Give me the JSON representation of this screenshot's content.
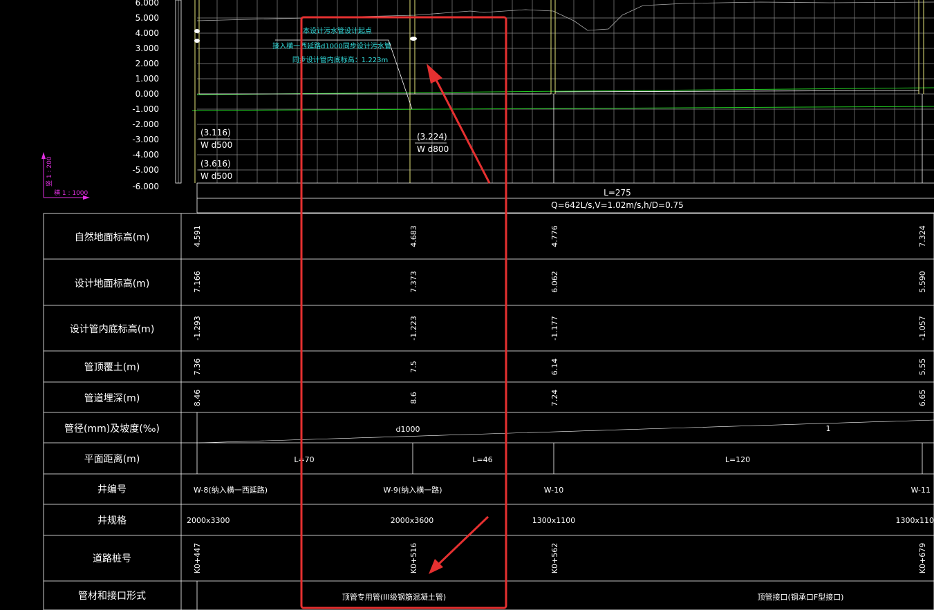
{
  "elevation_ticks": [
    "6.000",
    "5.000",
    "4.000",
    "3.000",
    "2.000",
    "1.000",
    "0.000",
    "-1.000",
    "-2.000",
    "-3.000",
    "-4.000",
    "-5.000",
    "-6.000"
  ],
  "scale": {
    "vertical": "竖 1 : 200",
    "horizontal": "横 1 : 1000"
  },
  "annotation": {
    "line1": "本设计污水管设计起点",
    "line2": "接入横一西延路d1000同步设计污水管",
    "line3": "同步设计管内底标高：1.223m"
  },
  "pipe_labels": {
    "a_elev": "(3.116)",
    "a_spec": "W d500",
    "b_elev": "(3.616)",
    "b_spec": "W d500",
    "c_elev": "(3.224)",
    "c_spec": "W d800"
  },
  "segment": {
    "length": "L=275",
    "flow": "Q=642L/s,V=1.02m/s,h/D=0.75"
  },
  "rows": [
    {
      "label": "自然地面标高(m)",
      "values": [
        "4.591",
        "4.683",
        "4.776",
        "7.324"
      ]
    },
    {
      "label": "设计地面标高(m)",
      "values": [
        "7.166",
        "7.373",
        "6.062",
        "5.590"
      ]
    },
    {
      "label": "设计管内底标高(m)",
      "values": [
        "-1.293",
        "-1.223",
        "-1.177",
        "-1.057"
      ]
    },
    {
      "label": "管顶覆土(m)",
      "values": [
        "7.36",
        "7.5",
        "6.14",
        "5.55"
      ]
    },
    {
      "label": "管道埋深(m)",
      "values": [
        "8.46",
        "8.6",
        "7.24",
        "6.65"
      ]
    },
    {
      "label": "管径(mm)及坡度(‰)",
      "values": [
        "d1000",
        "1"
      ]
    },
    {
      "label": "平面距离(m)",
      "values": [
        "L=70",
        "L=46",
        "L=120"
      ]
    },
    {
      "label": "井编号",
      "values": [
        "W-8(纳入横一西延路)",
        "W-9(纳入横一路)",
        "W-10",
        "W-11"
      ]
    },
    {
      "label": "井规格",
      "values": [
        "2000x3300",
        "2000x3600",
        "1300x1100",
        "1300x110"
      ]
    },
    {
      "label": "道路桩号",
      "values": [
        "K0+447",
        "K0+516",
        "K0+562",
        "K0+679"
      ]
    },
    {
      "label": "管材和接口形式",
      "values": [
        "顶管专用管(III级钢筋混凝土管)",
        "顶管接口(钢承口F型接口)"
      ]
    }
  ],
  "colors": {
    "grid": "#8a8a8a",
    "green": "#22cc22",
    "yellow": "#e6e67a",
    "cyan": "#33e0e0",
    "highlight": "#e53030",
    "magenta": "#e030e0"
  }
}
